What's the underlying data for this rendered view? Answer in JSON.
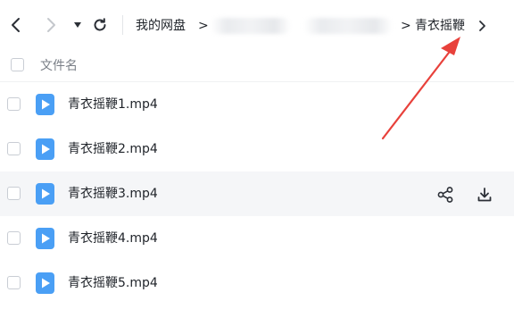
{
  "nav": {
    "back_icon": "chevron-left-icon",
    "forward_icon": "chevron-right-icon",
    "dropdown_icon": "caret-down-icon",
    "refresh_icon": "refresh-icon"
  },
  "breadcrumb": {
    "root": "我的网盘",
    "separator": ">",
    "current": "青衣摇鞭",
    "trailing_icon": "chevron-right-icon"
  },
  "list": {
    "column_header": "文件名"
  },
  "files": [
    {
      "name": "青衣摇鞭1.mp4",
      "icon": "video-file-icon"
    },
    {
      "name": "青衣摇鞭2.mp4",
      "icon": "video-file-icon"
    },
    {
      "name": "青衣摇鞭3.mp4",
      "icon": "video-file-icon",
      "hovered": true,
      "actions": [
        "share-icon",
        "download-icon"
      ]
    },
    {
      "name": "青衣摇鞭4.mp4",
      "icon": "video-file-icon"
    },
    {
      "name": "青衣摇鞭5.mp4",
      "icon": "video-file-icon"
    }
  ],
  "colors": {
    "file_icon": "#4a9ff5",
    "annotation_arrow": "#e8413b",
    "hover_row": "#f5f6f8"
  }
}
